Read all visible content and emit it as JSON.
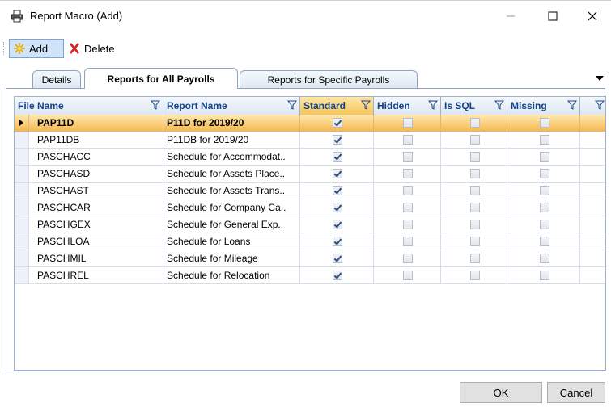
{
  "window": {
    "title": "Report Macro (Add)"
  },
  "toolbar": {
    "add_label": "Add",
    "delete_label": "Delete"
  },
  "tabs": [
    {
      "label": "Details",
      "active": false
    },
    {
      "label": "Reports for All Payrolls",
      "active": true
    },
    {
      "label": "Reports for Specific Payrolls",
      "active": false
    }
  ],
  "grid": {
    "columns": [
      "File Name",
      "Report Name",
      "Standard",
      "Hidden",
      "Is SQL",
      "Missing"
    ],
    "rows": [
      {
        "file": "PAP11D",
        "report": "P11D for 2019/20",
        "standard": true,
        "hidden": false,
        "is_sql": false,
        "missing": false,
        "selected": true
      },
      {
        "file": "PAP11DB",
        "report": "P11DB for 2019/20",
        "standard": true,
        "hidden": false,
        "is_sql": false,
        "missing": false
      },
      {
        "file": "PASCHACC",
        "report": "Schedule for Accommodat..",
        "standard": true,
        "hidden": false,
        "is_sql": false,
        "missing": false
      },
      {
        "file": "PASCHASD",
        "report": "Schedule for Assets Place..",
        "standard": true,
        "hidden": false,
        "is_sql": false,
        "missing": false
      },
      {
        "file": "PASCHAST",
        "report": "Schedule for Assets Trans..",
        "standard": true,
        "hidden": false,
        "is_sql": false,
        "missing": false
      },
      {
        "file": "PASCHCAR",
        "report": "Schedule for Company Ca..",
        "standard": true,
        "hidden": false,
        "is_sql": false,
        "missing": false
      },
      {
        "file": "PASCHGEX",
        "report": "Schedule for General Exp..",
        "standard": true,
        "hidden": false,
        "is_sql": false,
        "missing": false
      },
      {
        "file": "PASCHLOA",
        "report": "Schedule for Loans",
        "standard": true,
        "hidden": false,
        "is_sql": false,
        "missing": false
      },
      {
        "file": "PASCHMIL",
        "report": "Schedule for Mileage",
        "standard": true,
        "hidden": false,
        "is_sql": false,
        "missing": false
      },
      {
        "file": "PASCHREL",
        "report": "Schedule for Relocation",
        "standard": true,
        "hidden": false,
        "is_sql": false,
        "missing": false
      }
    ]
  },
  "buttons": {
    "ok": "OK",
    "cancel": "Cancel"
  },
  "icons": {
    "app": "printer-icon",
    "add": "sparkle-add-icon",
    "delete": "red-x-icon",
    "filter": "funnel-filter-icon"
  },
  "colors": {
    "selected_row": "#f7c65a",
    "header_text": "#15428b",
    "delete_red": "#d9201c"
  }
}
